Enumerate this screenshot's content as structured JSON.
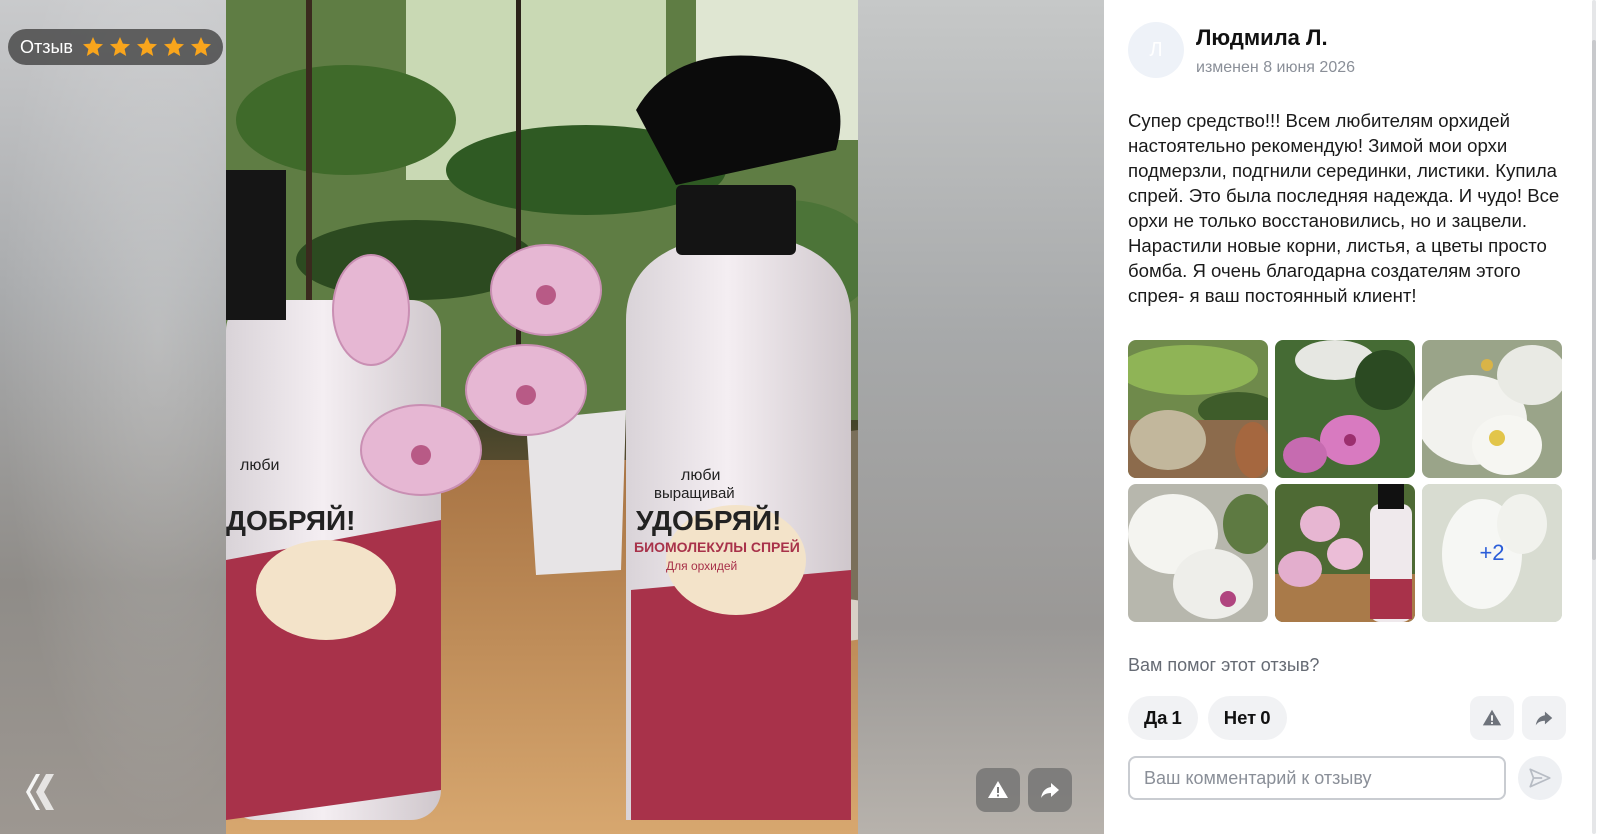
{
  "viewer": {
    "badge": {
      "label": "Отзыв",
      "rating": 5,
      "star_icon": "star-icon",
      "star_color": "#f9a51c"
    },
    "logo_icon": "brand-logo-icon",
    "actions": [
      {
        "icon": "report-icon"
      },
      {
        "icon": "share-icon"
      }
    ],
    "photo_text": {
      "line1": "люби",
      "line2": "выращивай",
      "line3": "УДОБРЯЙ!",
      "line4": "БИОМОЛЕКУЛЫ СПРЕЙ",
      "line5": "Для орхидей"
    }
  },
  "review": {
    "avatar_letter": "Л",
    "author": "Людмила Л.",
    "date": "изменен 8 июня 2026",
    "text": "Супер средство!!! Всем любителям орхидей настоятельно рекомендую! Зимой мои орхи подмерзли, подгнили серединки, листики. Купила спрей. Это была последняя надежда. И чудо! Все орхи не только восстановились, но и зацвели. Нарастили новые корни, листья, а цветы просто бомба. Я очень благодарна создателям этого спрея- я ваш постоянный клиент!",
    "thumbnails_more": "+2",
    "helpful_question": "Вам помог этот отзыв?",
    "vote_yes_label": "Да",
    "vote_yes_count": "1",
    "vote_no_label": "Нет",
    "vote_no_count": "0",
    "comment_placeholder": "Ваш комментарий к отзыву",
    "colors": {
      "accent": "#2a5dd8",
      "muted": "#8a8f98",
      "button_bg": "#f1f2f4"
    }
  }
}
